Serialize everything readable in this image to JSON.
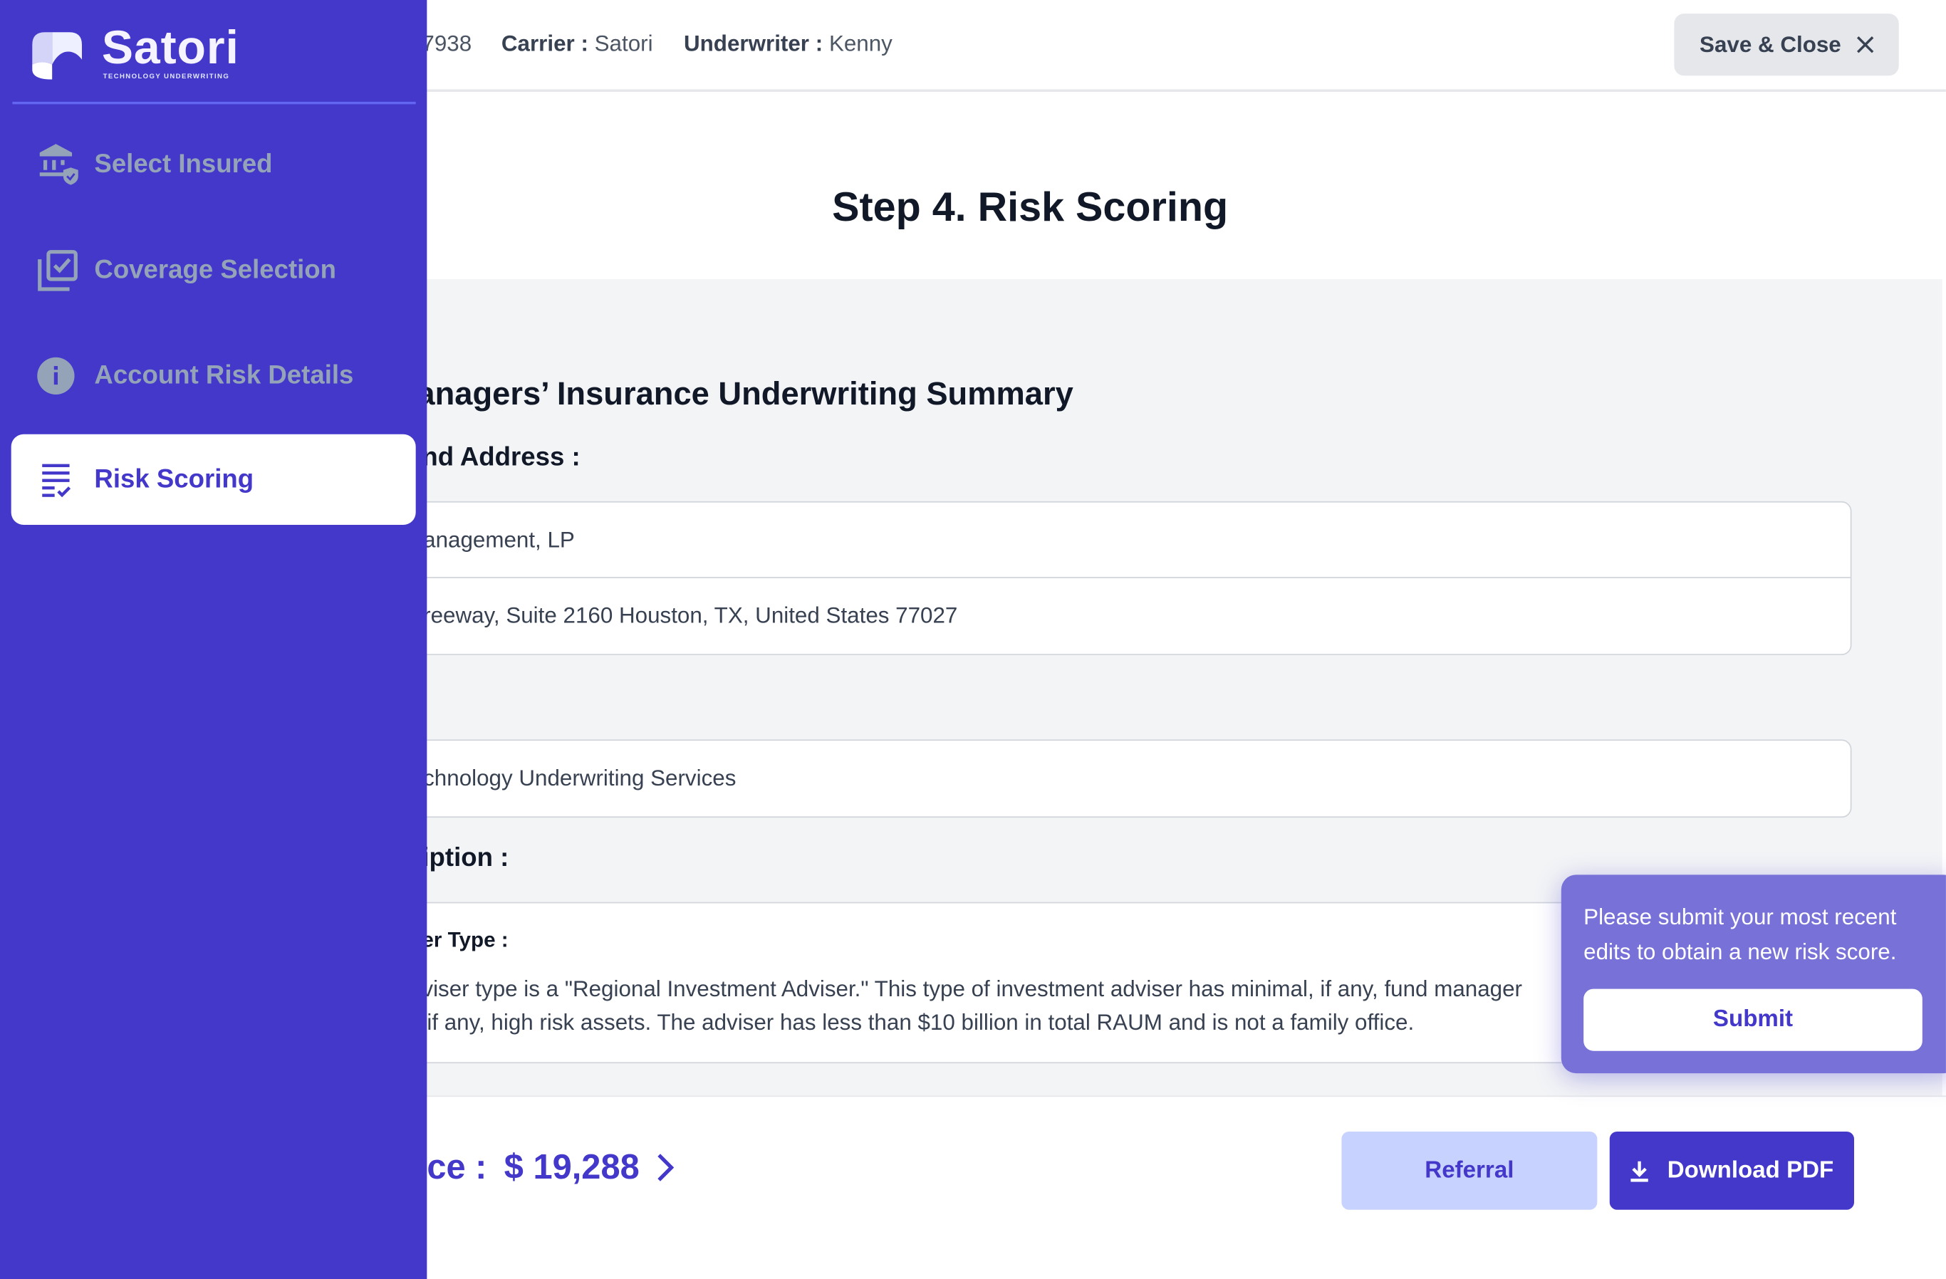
{
  "header": {
    "policy_fragment": "7938",
    "carrier_label": "Carrier :",
    "carrier_value": "Satori",
    "underwriter_label": "Underwriter :",
    "underwriter_value": "Kenny",
    "save_close_label": "Save & Close"
  },
  "page_title": "Step 4. Risk Scoring",
  "summary": {
    "heading": "anagers’ Insurance Underwriting Summary",
    "address_label": "nd Address :",
    "name_value": "anagement, LP",
    "address_value": "reeway, Suite 2160 Houston, TX, United States 77027",
    "broker_value": "chnology Underwriting Services",
    "description_label": "iption :",
    "adviser_type_label": "er Type :",
    "adviser_type_line1": "viser type is a \"Regional Investment Adviser.\" This type of investment adviser has minimal, if any, fund manager",
    "adviser_type_line2": "if any, high risk assets. The adviser has less than $10 billion in total RAUM and is not a family office."
  },
  "footer": {
    "price_label": "ce :",
    "price_value": "$ 19,288",
    "referral_label": "Referral",
    "download_label": "Download PDF"
  },
  "popup": {
    "message": "Please submit your most recent edits to obtain a new risk score.",
    "submit_label": "Submit"
  },
  "sidebar": {
    "brand": "Satori",
    "brand_sub": "TECHNOLOGY UNDERWRITING",
    "items": [
      {
        "label": "Select Insured",
        "icon": "bank-shield-icon"
      },
      {
        "label": "Coverage Selection",
        "icon": "checkbox-stack-icon"
      },
      {
        "label": "Account Risk Details",
        "icon": "info-icon"
      },
      {
        "label": "Risk Scoring",
        "icon": "list-check-icon",
        "active": true
      }
    ]
  },
  "colors": {
    "primary": "#4338ca",
    "popup": "#7872d8",
    "referral_bg": "#c7d2fe",
    "muted_icon": "#94a3b8"
  }
}
